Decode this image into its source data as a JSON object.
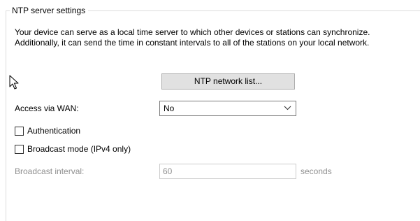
{
  "groupbox": {
    "title": "NTP server settings",
    "description": "Your device can serve as a local time server to which other devices or stations can synchronize. Additionally, it can send the time in constant intervals to all of the stations on your local network."
  },
  "ntp_network_list_button": {
    "label": "NTP network list..."
  },
  "access_via_wan": {
    "label": "Access via WAN:",
    "selected_value": "No"
  },
  "authentication": {
    "label": "Authentication",
    "checked": false
  },
  "broadcast_mode": {
    "label": "Broadcast mode (IPv4 only)",
    "checked": false
  },
  "broadcast_interval": {
    "label": "Broadcast interval:",
    "value": "60",
    "unit": "seconds",
    "enabled": false
  },
  "colors": {
    "button_bg": "#e1e1e1",
    "disabled_text": "#8f8f8f",
    "groupbox_border": "#dcdcdc"
  },
  "icons": {
    "cursor": "mouse-pointer-icon",
    "dropdown": "chevron-down-icon"
  }
}
